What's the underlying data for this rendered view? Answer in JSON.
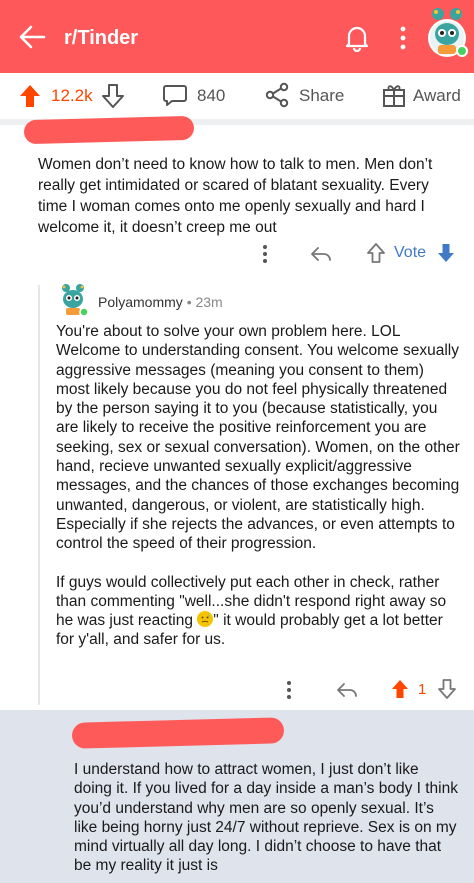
{
  "header": {
    "subreddit": "r/Tinder",
    "background_color": "#ff585b"
  },
  "action_bar": {
    "upvotes": "12.2k",
    "comments": "840",
    "share_label": "Share",
    "award_label": "Award",
    "upvote_color": "#ff4500"
  },
  "comment1": {
    "body": "Women don’t need to know how to talk to men. Men don’t really get intimidated or scared of blatant sexuality. Every time I woman comes onto me openly sexually and hard I welcome it, it doesn’t creep me out",
    "vote_label": "Vote"
  },
  "reply": {
    "username": "Polyamommy",
    "time": "• 23m",
    "paragraph1": "You're about to solve your own problem here. LOL Welcome to understanding consent. You welcome sexually aggressive messages (meaning you consent to them) most likely because you do not feel physically threatened by the person saying it to you (because statistically, you are likely to receive the positive reinforcement you are seeking, sex or sexual conversation). Women, on the other hand, recieve unwanted sexually explicit/aggressive messages, and the chances of those exchanges becoming unwanted, dangerous, or violent, are statistically high. Especially if she rejects the advances, or even attempts to control the speed of their progression.",
    "paragraph2_before_emoji": "If guys would collectively put each other in check, rather than commenting \"well...she didn't respond right away so he was just reacting ",
    "paragraph2_after_emoji": "\" it would probably get a lot better for y'all, and safer for us.",
    "vote_count": "1"
  },
  "comment3": {
    "body": "I understand how to attract women, I just don’t like doing it. If you lived for a day inside a man’s body I think you’d understand why men are so openly sexual. It’s like being horny just 24/7 without reprieve. Sex is on my mind virtually all day long. I didn’t choose to have that be my reality it just is"
  }
}
